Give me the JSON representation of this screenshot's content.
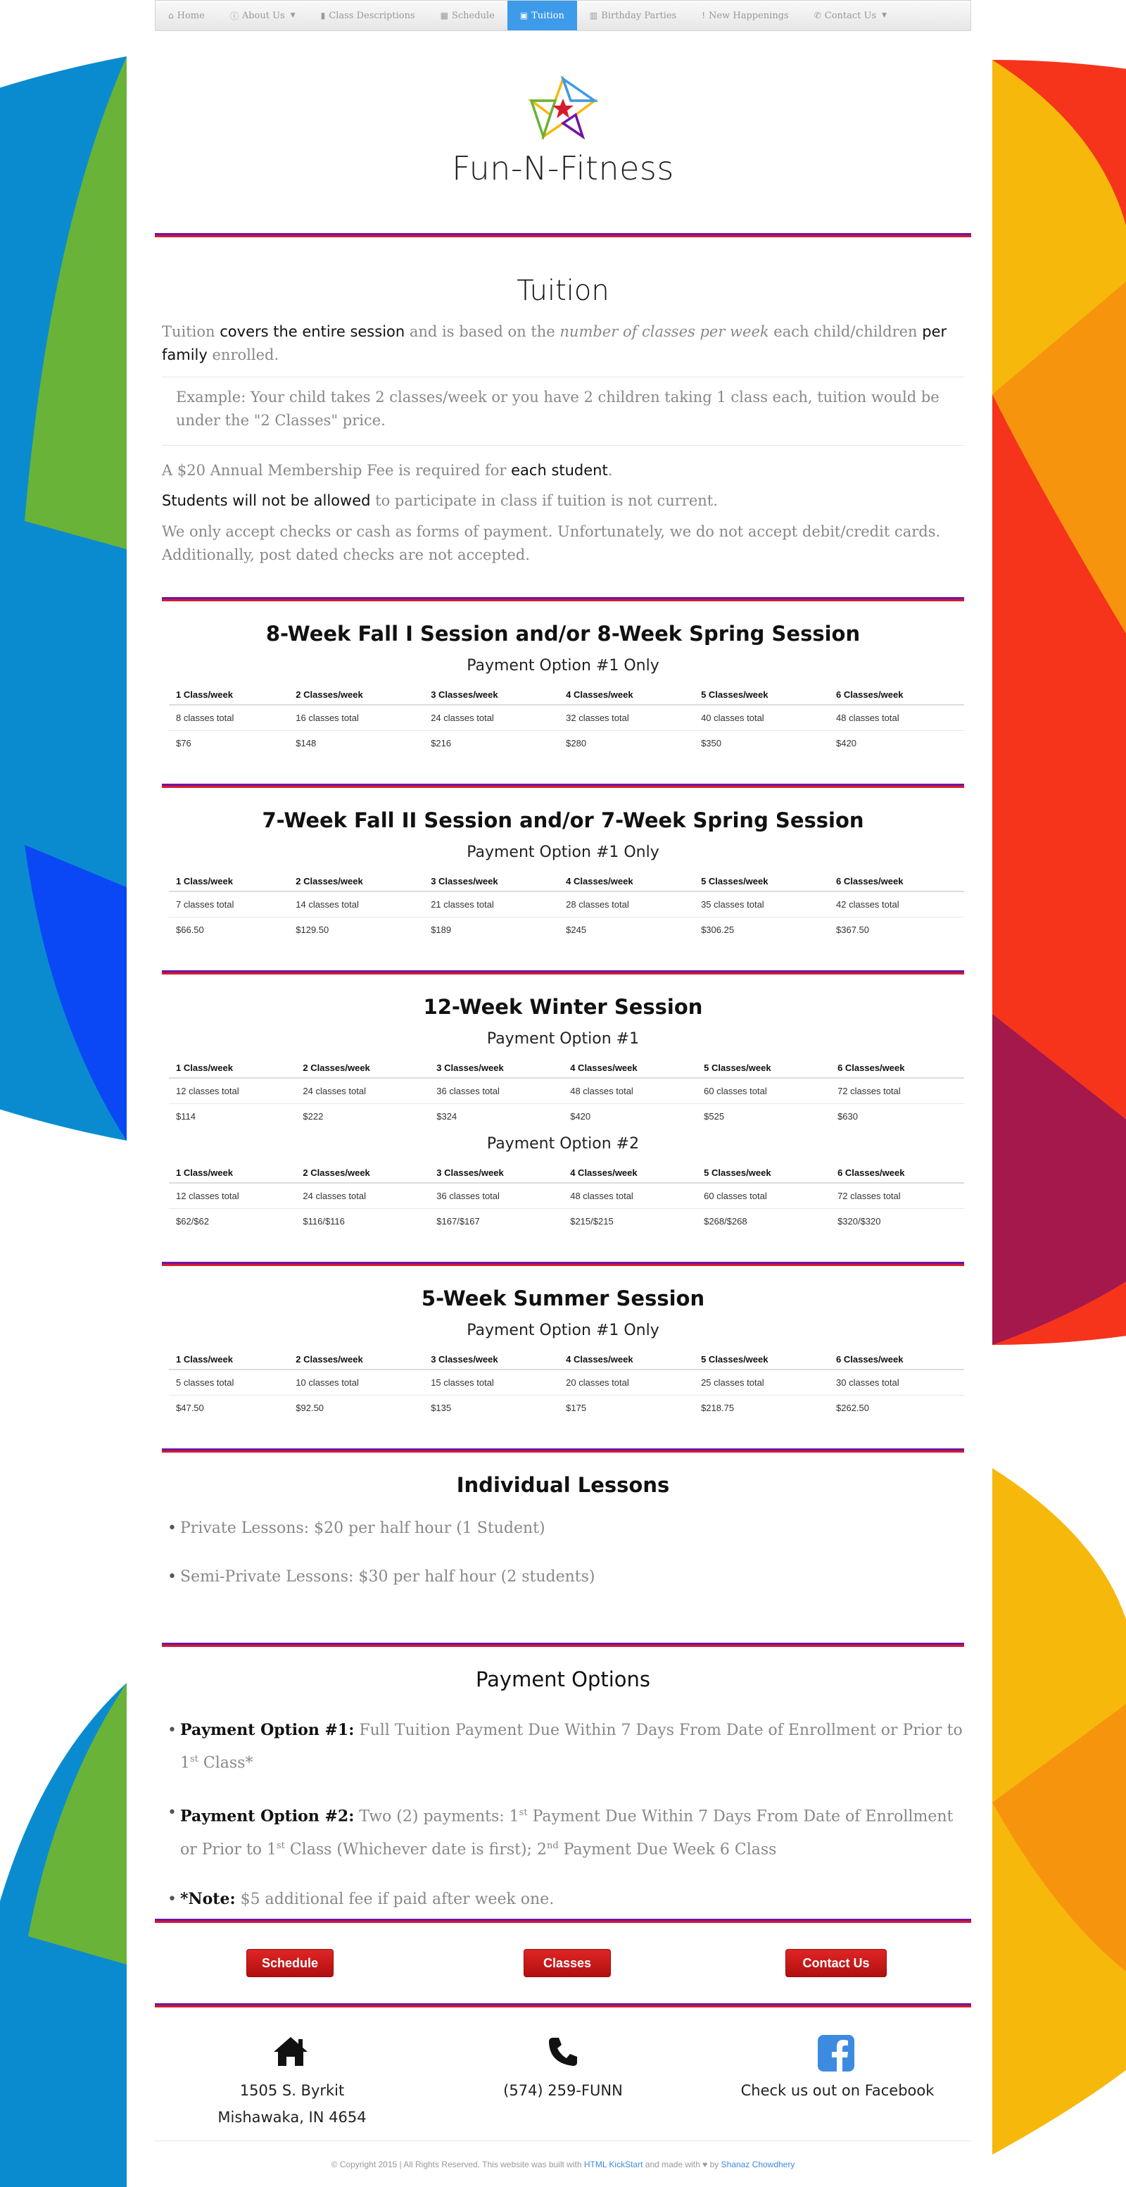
{
  "colors": {
    "accent": "#3d9bea",
    "rule_top": "#6f15a6",
    "rule_bottom": "#d81b2b",
    "button": "#cc1a1a",
    "deco_yellow": "#f7b80c",
    "deco_orange": "#f7940e",
    "deco_red": "#f5341b",
    "deco_crimson": "#a4184c",
    "deco_green": "#69b338",
    "deco_teal": "#0b8bcf",
    "deco_blue": "#0a48f5"
  },
  "nav": {
    "items": [
      {
        "icon": "home-icon",
        "glyph": "⌂",
        "label": "Home"
      },
      {
        "icon": "info-circle-icon",
        "glyph": "ⓘ",
        "label": "About Us",
        "dropdown": true
      },
      {
        "icon": "book-icon",
        "glyph": "▮",
        "label": "Class Descriptions"
      },
      {
        "icon": "calendar-icon",
        "glyph": "▦",
        "label": "Schedule"
      },
      {
        "icon": "money-icon",
        "glyph": "▣",
        "label": "Tuition",
        "active": true
      },
      {
        "icon": "birthday-cake-icon",
        "glyph": "▥",
        "label": "Birthday Parties"
      },
      {
        "icon": "exclamation-icon",
        "glyph": "!",
        "label": "New Happenings"
      },
      {
        "icon": "phone-icon",
        "glyph": "✆",
        "label": "Contact Us",
        "dropdown": true
      }
    ]
  },
  "header": {
    "title": "Fun-N-Fitness"
  },
  "tuition": {
    "title": "Tuition",
    "intro": {
      "p1": "Tuition ",
      "p2": "covers the entire session",
      "p3": " and is based on the ",
      "p4": "number of classes per week",
      "p5": " each child/children ",
      "p6": "per family",
      "p7": " enrolled."
    },
    "example": "Example: Your child takes 2 classes/week or you have 2 children taking 1 class each, tuition would be under the \"2 Classes\" price.",
    "fee": {
      "p1": "A $20 Annual Membership Fee is required for ",
      "p2": "each student",
      "p3": "."
    },
    "current": {
      "p1": "Students will not be allowed",
      "p2": " to participate in class if tuition is not current."
    },
    "payment_note": "We only accept checks or cash as forms of payment. Unfortunately, we do not accept debit/credit cards. Additionally, post dated checks are not accepted."
  },
  "headers": [
    "1 Class/week",
    "2 Classes/week",
    "3 Classes/week",
    "4 Classes/week",
    "5 Classes/week",
    "6 Classes/week"
  ],
  "sessions": [
    {
      "title": "8-Week Fall I Session and/or 8-Week Spring Session",
      "option": "Payment Option #1 Only",
      "totals": [
        "8 classes total",
        "16 classes total",
        "24 classes total",
        "32 classes total",
        "40 classes total",
        "48 classes total"
      ],
      "prices": [
        "$76",
        "$148",
        "$216",
        "$280",
        "$350",
        "$420"
      ]
    },
    {
      "title": "7-Week Fall II Session and/or 7-Week Spring Session",
      "option": "Payment Option #1 Only",
      "totals": [
        "7 classes total",
        "14 classes total",
        "21 classes total",
        "28 classes total",
        "35 classes total",
        "42 classes total"
      ],
      "prices": [
        "$66.50",
        "$129.50",
        "$189",
        "$245",
        "$306.25",
        "$367.50"
      ]
    },
    {
      "title": "12-Week Winter Session",
      "option": "Payment Option #1",
      "totals": [
        "12 classes total",
        "24 classes total",
        "36 classes total",
        "48 classes total",
        "60 classes total",
        "72 classes total"
      ],
      "prices": [
        "$114",
        "$222",
        "$324",
        "$420",
        "$525",
        "$630"
      ],
      "option2": "Payment Option #2",
      "totals2": [
        "12 classes total",
        "24 classes total",
        "36 classes total",
        "48 classes total",
        "60 classes total",
        "72 classes total"
      ],
      "prices2": [
        "$62/$62",
        "$116/$116",
        "$167/$167",
        "$215/$215",
        "$268/$268",
        "$320/$320"
      ]
    },
    {
      "title": "5-Week Summer Session",
      "option": "Payment Option #1 Only",
      "totals": [
        "5 classes total",
        "10 classes total",
        "15 classes total",
        "20 classes total",
        "25 classes total",
        "30 classes total"
      ],
      "prices": [
        "$47.50",
        "$92.50",
        "$135",
        "$175",
        "$218.75",
        "$262.50"
      ]
    }
  ],
  "lessons": {
    "title": "Individual Lessons",
    "items": [
      "Private Lessons: $20 per half hour (1 Student)",
      "Semi-Private Lessons: $30 per half hour (2 students)"
    ]
  },
  "payment_options": {
    "title": "Payment Options",
    "opt1_label": "Payment Option #1:",
    "opt1_a": " Full Tuition Payment Due Within 7 Days From Date of Enrollment or Prior to 1",
    "opt1_sup": "st",
    "opt1_b": " Class*",
    "opt2_label": "Payment Option #2:",
    "opt2_a": " Two (2) payments: 1",
    "opt2_sup1": "st",
    "opt2_b": " Payment Due Within 7 Days From Date of Enrollment or Prior to 1",
    "opt2_sup2": "st",
    "opt2_c": " Class (Whichever date is first); 2",
    "opt2_sup3": "nd",
    "opt2_d": " Payment Due Week 6 Class",
    "note_label": "*Note:",
    "note_text": " $5 additional fee if paid after week one."
  },
  "buttons": {
    "schedule": "Schedule",
    "classes": "Classes",
    "contact": "Contact Us"
  },
  "footer": {
    "address1": "1505 S. Byrkit",
    "address2": "Mishawaka, IN 4654",
    "phone": "(574) 259-FUNN",
    "facebook": "Check us out on Facebook",
    "copy1": "© Copyright 2015 | All Rights Reserved. This website was built with ",
    "copy_link1": "HTML KickStart",
    "copy2": " and made with ",
    "copy3": " by ",
    "copy_link2": "Shanaz Chowdhery"
  }
}
